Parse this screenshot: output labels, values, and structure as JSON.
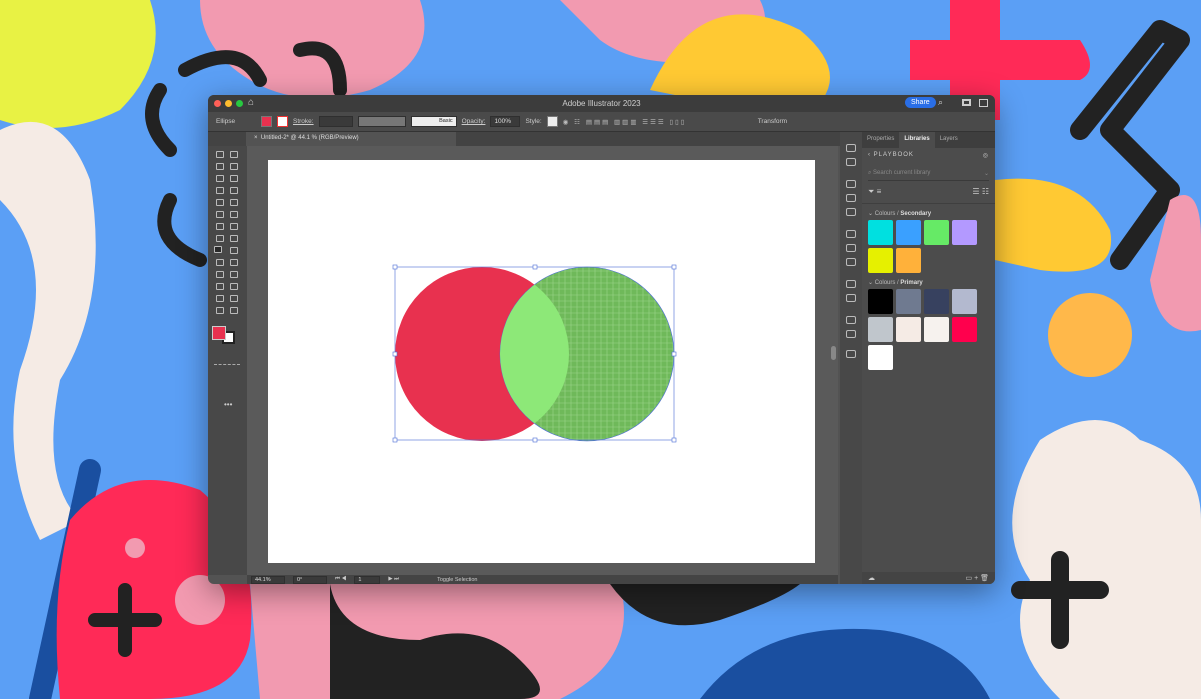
{
  "window": {
    "title": "Adobe Illustrator 2023",
    "share": "Share"
  },
  "control_bar": {
    "object": "Ellipse",
    "fill_color": "#e8314f",
    "stroke_label": "Stroke:",
    "brush": "Basic",
    "opacity_label": "Opacity:",
    "opacity": "100%",
    "style_label": "Style:",
    "transform": "Transform"
  },
  "document_tab": {
    "close": "×",
    "title": "Untitled-2* @ 44.1 % (RGB/Preview)"
  },
  "status_bar": {
    "zoom": "44.1%",
    "rotation": "0°",
    "artboard": "1",
    "mode": "Toggle Selection"
  },
  "panel": {
    "tabs": [
      "Properties",
      "Libraries",
      "Layers"
    ],
    "library": "PLAYBOOK",
    "search_placeholder": "Search current library",
    "groups": [
      {
        "prefix": "Colours / ",
        "name": "Secondary",
        "colors": [
          "#00e0e0",
          "#3aa0ff",
          "#66ea66",
          "#b399ff",
          "#e6f000",
          "#ffb13a"
        ]
      },
      {
        "prefix": "Colours / ",
        "name": "Primary",
        "colors": [
          "#000000",
          "#6f7a90",
          "#37415f",
          "#b3b9cf",
          "#c0c6cc",
          "#f5ebe5",
          "#f6f2ee",
          "#ff004d",
          "#ffffff"
        ]
      }
    ]
  },
  "artwork": {
    "left_circle": "#e8314f",
    "intersection": "#8de878",
    "right_circle": "#6fb95a"
  }
}
